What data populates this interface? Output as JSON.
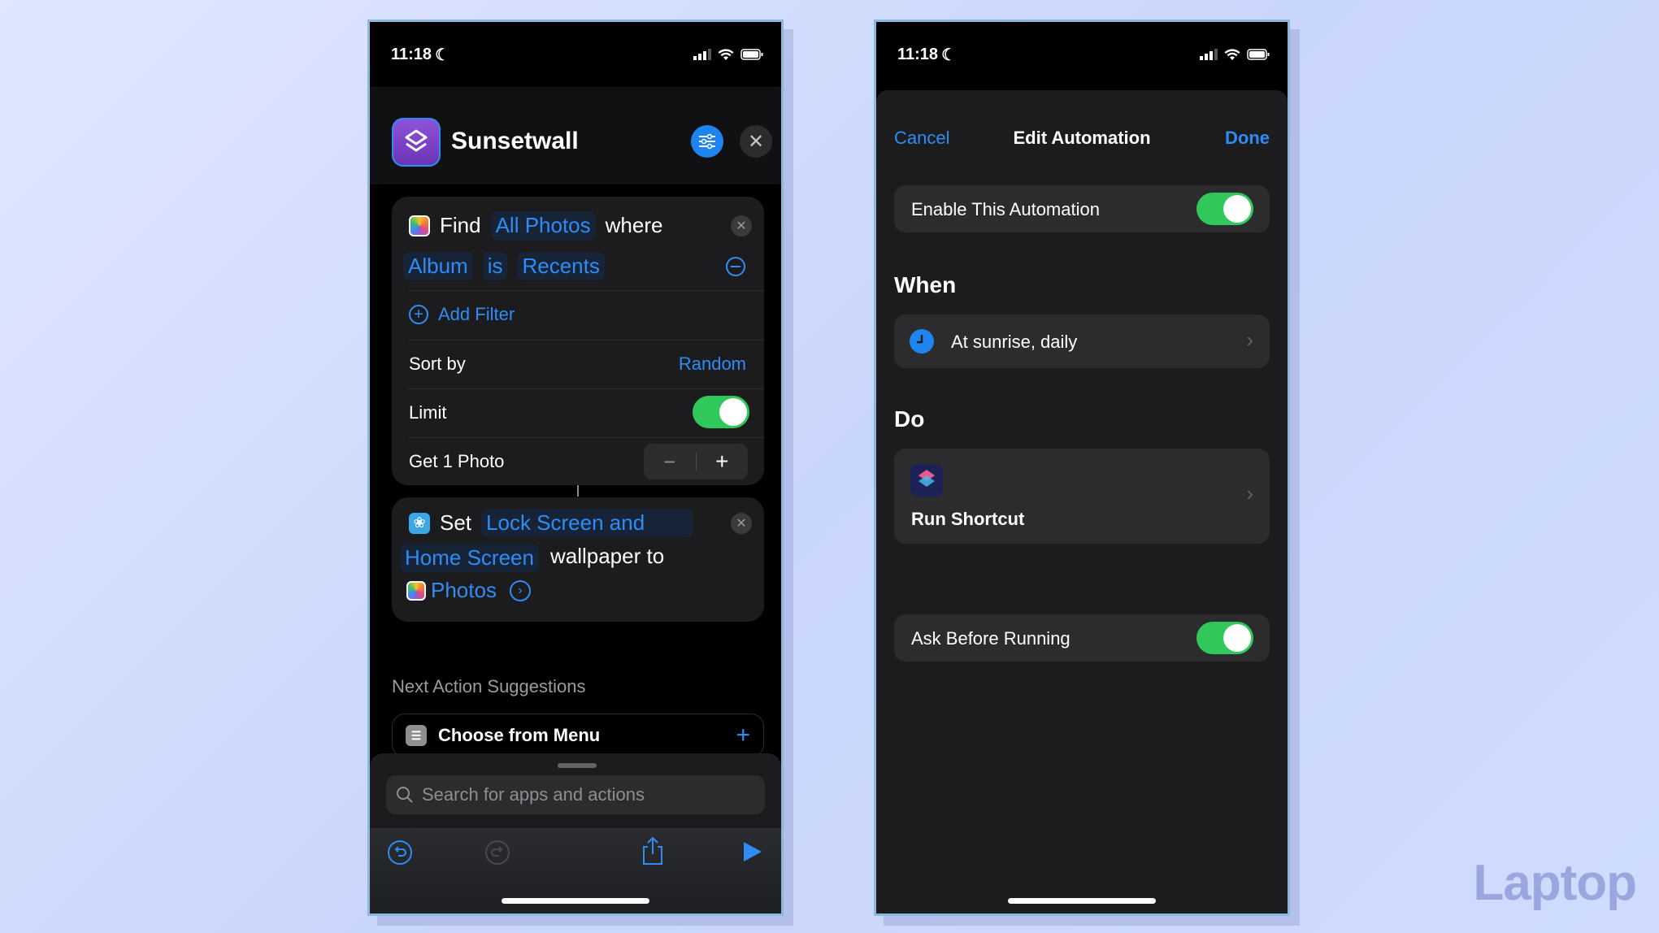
{
  "left_phone": {
    "status": {
      "time": "11:18"
    },
    "header": {
      "title": "Sunsetwall"
    },
    "find_action": {
      "verb": "Find",
      "source": "All Photos",
      "connector": "where",
      "filter": {
        "field": "Album",
        "operator": "is",
        "value": "Recents"
      },
      "add_filter_label": "Add Filter",
      "sort_by_label": "Sort by",
      "sort_by_value": "Random",
      "limit_label": "Limit",
      "limit_enabled": true,
      "get_label": "Get 1 Photo"
    },
    "set_action": {
      "verb": "Set",
      "target_line1": "Lock Screen and",
      "target_line2": "Home Screen",
      "suffix": "wallpaper to",
      "variable": "Photos"
    },
    "suggestions": {
      "heading": "Next Action Suggestions",
      "items": [
        {
          "label": "Choose from Menu"
        }
      ]
    },
    "search": {
      "placeholder": "Search for apps and actions"
    }
  },
  "right_phone": {
    "status": {
      "time": "11:18"
    },
    "nav": {
      "cancel": "Cancel",
      "title": "Edit Automation",
      "done": "Done"
    },
    "enable_label": "Enable This Automation",
    "enable_on": true,
    "when_heading": "When",
    "trigger": "At sunrise, daily",
    "do_heading": "Do",
    "action": "Run Shortcut",
    "ask_label": "Ask Before Running",
    "ask_on": true
  },
  "watermark": "Laptop",
  "colors": {
    "accent": "#2f8cf5",
    "toggle_on": "#30c85a",
    "card": "#1c1c1e"
  }
}
